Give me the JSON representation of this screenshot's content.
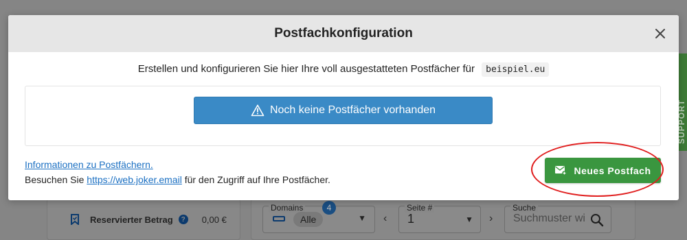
{
  "background": {
    "reserved_label": "Reservierter Betrag",
    "reserved_help": "?",
    "reserved_amount": "0,00 €",
    "domains_label": "Domains",
    "domains_count": "4",
    "domains_value": "Alle",
    "page_label": "Seite #",
    "page_value": "1",
    "search_label": "Suche",
    "search_placeholder": "Suchmuster wi"
  },
  "support_tab": {
    "label": "SUPPORT"
  },
  "modal": {
    "title": "Postfachkonfiguration",
    "intro_text": "Erstellen und konfigurieren Sie hier Ihre voll ausgestatteten Postfächer für",
    "domain": "beispiel.eu",
    "empty_message": "Noch keine Postfächer vorhanden",
    "info_link": "Informationen zu Postfächern.",
    "visit_prefix": "Besuchen Sie",
    "visit_link": "https://web.joker.email",
    "visit_suffix": "für den Zugriff auf Ihre Postfächer.",
    "new_button": "Neues Postfach"
  },
  "colors": {
    "primary_blue": "#3a8ac6",
    "success_green": "#3a963f",
    "link_blue": "#1a6fc2",
    "annotation_red": "#e01d1d"
  }
}
